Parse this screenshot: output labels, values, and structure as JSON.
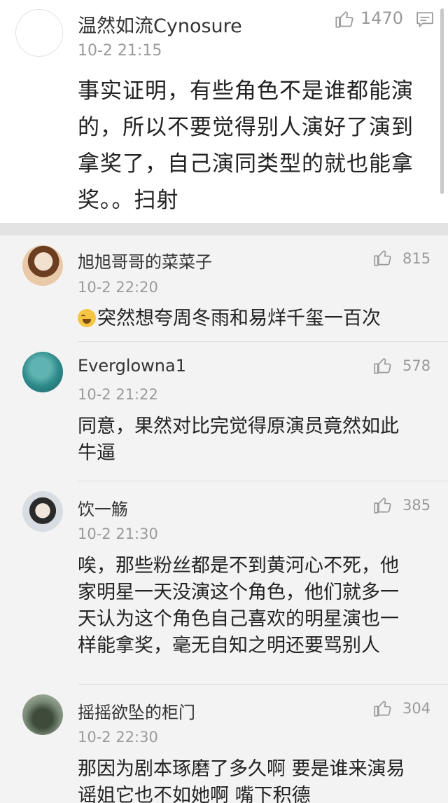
{
  "main_comment": {
    "username": "温然如流Cynosure",
    "time": "10-2 21:15",
    "likes": "1470",
    "text": "事实证明，有些角色不是谁都能演的，所以不要觉得别人演好了演到拿奖了，自己演同类型的就也能拿奖。。扫射",
    "text_lines": [
      "事实证明，有些角色不是谁都能演",
      "的，所以不要觉得别人演好了演到",
      "拿奖了，自己演同类型的就也能拿",
      "奖。。扫射"
    ]
  },
  "replies": [
    {
      "username": "旭旭哥哥的菜菜子",
      "time": "10-2 22:20",
      "likes": "815",
      "text": "突然想夸周冬雨和易烊千玺一百次",
      "has_emoji": true,
      "avatar_colors": [
        "#e9c9a8",
        "#6b3e22",
        "#f3e1cf"
      ]
    },
    {
      "username": "Everglowna1",
      "time": "10-2 21:22",
      "likes": "578",
      "text_lines": [
        "同意，果然对比完觉得原演员竟然如此",
        "牛逼"
      ],
      "avatar_colors": [
        "#2e8a8a",
        "#5fb3b0",
        "#1d5f63"
      ]
    },
    {
      "username": "饮一觞",
      "time": "10-2 21:30",
      "likes": "385",
      "text_lines": [
        "唉，那些粉丝都是不到黄河心不死，他",
        "家明星一天没演这个角色，他们就多一",
        "天认为这个角色自己喜欢的明星演也一",
        "样能拿奖，毫无自知之明还要骂别人"
      ],
      "avatar_colors": [
        "#d8dde3",
        "#2a2a2a",
        "#f0e6dc"
      ]
    },
    {
      "username": "摇摇欲坠的柜门",
      "time": "10-2 22:30",
      "likes": "304",
      "text_lines": [
        "那因为剧本琢磨了多久啊 要是谁来演易",
        "谣姐它也不如她啊 嘴下积德"
      ],
      "avatar_colors": [
        "#7a8a78",
        "#3e4a3a",
        "#b9c2b0"
      ]
    }
  ],
  "icons": {
    "like": "thumbs-up-icon",
    "comment": "comment-icon"
  },
  "colors": {
    "background": "#f3f3f3",
    "main_background": "#ffffff",
    "divider": "#e3e3e3",
    "secondary_text": "#9a9a9a"
  }
}
